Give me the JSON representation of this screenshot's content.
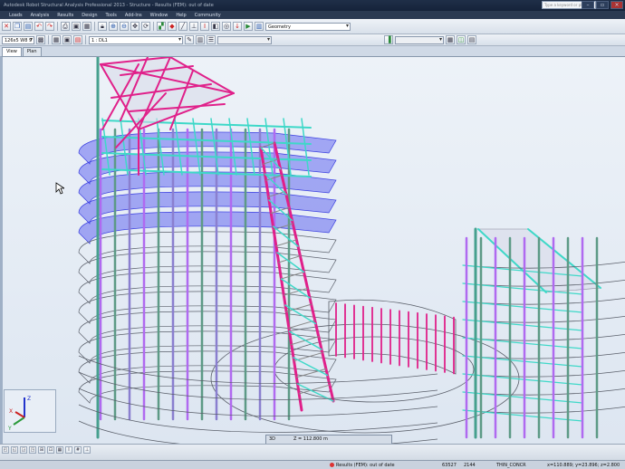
{
  "window": {
    "title": "Autodesk Robot Structural Analysis Professional 2013 - Structure - Results (FEM): out of date",
    "search_placeholder": "Type a keyword or phrase",
    "controls": {
      "minimize": "–",
      "maximize": "▫",
      "close": "×"
    }
  },
  "menu": {
    "items": [
      "Loads",
      "Analysis",
      "Results",
      "Design",
      "Tools",
      "Add-Ins",
      "Window",
      "Help",
      "Community"
    ]
  },
  "toolbar1": {
    "layout_combo": "Geometry",
    "icons": [
      "close-icon",
      "copy-icon",
      "paste-icon",
      "undo-icon",
      "redo-icon",
      "print-icon",
      "preview-icon",
      "table-icon",
      "lock-icon",
      "zoom-in-icon",
      "zoom-out-icon",
      "pan-icon",
      "rotate-icon",
      "display-icon",
      "node-icon",
      "bar-icon",
      "support-icon",
      "section-icon",
      "material-icon",
      "release-icon",
      "load-icon",
      "calc-icon",
      "results-icon"
    ]
  },
  "toolbar2": {
    "section_combo": "126x5 W8 9",
    "case_combo": "1 : DL1",
    "right_combo": ""
  },
  "tabs": [
    {
      "label": "View",
      "active": true
    },
    {
      "label": "Plan",
      "active": false
    }
  ],
  "navbar": {
    "mode": "3D",
    "z_readout": "Z = 112.800 m",
    "slider_fraction": 0.95
  },
  "axes": {
    "z": "Z",
    "y": "Y",
    "x": "X"
  },
  "status": {
    "results": "Results (FEM): out of date",
    "nodes": "63527",
    "bars": "2144",
    "material": "THIN_CONCR",
    "coords": "x=110.889; y=23.896; z=2.800"
  },
  "colors": {
    "cyan_beam": "#3ed8c8",
    "magenta_beam": "#e0208a",
    "violet_column": "#b06af0",
    "slab_blue": "#4a4ef0",
    "slab_outline": "#5a5f6a"
  }
}
